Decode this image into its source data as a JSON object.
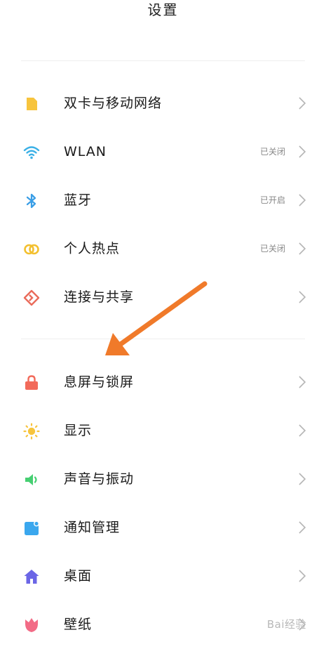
{
  "header": {
    "title": "设置"
  },
  "groups": [
    {
      "items": [
        {
          "label": "双卡与移动网络",
          "status": "",
          "icon": "sim-card-icon"
        },
        {
          "label": "WLAN",
          "status": "已关闭",
          "icon": "wifi-icon"
        },
        {
          "label": "蓝牙",
          "status": "已开启",
          "icon": "bluetooth-icon"
        },
        {
          "label": "个人热点",
          "status": "已关闭",
          "icon": "hotspot-icon"
        },
        {
          "label": "连接与共享",
          "status": "",
          "icon": "connection-share-icon"
        }
      ]
    },
    {
      "items": [
        {
          "label": "息屏与锁屏",
          "status": "",
          "icon": "lock-icon"
        },
        {
          "label": "显示",
          "status": "",
          "icon": "display-sun-icon"
        },
        {
          "label": "声音与振动",
          "status": "",
          "icon": "speaker-icon"
        },
        {
          "label": "通知管理",
          "status": "",
          "icon": "notification-icon"
        },
        {
          "label": "桌面",
          "status": "",
          "icon": "home-icon"
        },
        {
          "label": "壁纸",
          "status": "",
          "icon": "wallpaper-flower-icon"
        }
      ]
    }
  ],
  "annotation": {
    "arrow_color": "#f07a2a",
    "points_to": "息屏与锁屏"
  },
  "watermark": {
    "text": "Bai经验"
  },
  "colors": {
    "sim": "#f7c43d",
    "wifi": "#3ab0e6",
    "bluetooth": "#3a9ee6",
    "hotspot": "#f3c02f",
    "share": "#ea6b5a",
    "lock": "#f26a5a",
    "sun": "#f7c43d",
    "speaker": "#46cf72",
    "notify": "#3aa7ee",
    "home": "#6b66e6",
    "flower": "#f26b86"
  }
}
